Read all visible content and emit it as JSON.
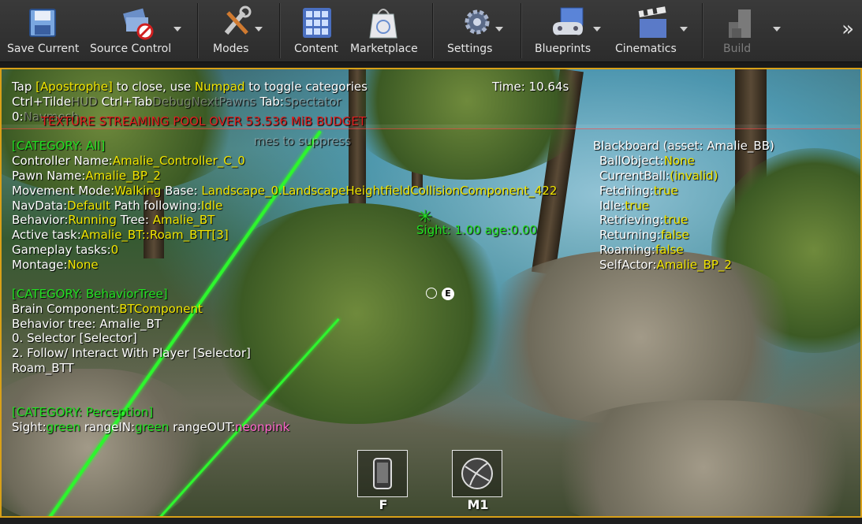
{
  "toolbar": {
    "save": "Save Current",
    "source_control": "Source Control",
    "modes": "Modes",
    "content": "Content",
    "marketplace": "Marketplace",
    "settings": "Settings",
    "blueprints": "Blueprints",
    "cinematics": "Cinematics",
    "build": "Build",
    "overflow": "»"
  },
  "hud": {
    "tap_a": "Tap ",
    "tap_key": "[Apostrophe]",
    "tap_b": " to close, use ",
    "tap_numpad": "Numpad",
    "tap_c": " to toggle categories",
    "time": "Time: 10.64s",
    "ctrl_tilde": "Ctrl+Tilde",
    "hud_word": "HUD",
    "ctrl_tab": "Ctrl+Tab",
    "ctrl_tab_faded": "DebugNextPawns",
    "tab_key": "Tab:",
    "spectator": "Spectator",
    "navmesh_key": "0:",
    "navmesh": "Navmesh",
    "texture_warning": "TEXTURE STREAMING POOL OVER 53.536 MiB BUDGET",
    "suppress": "mes to suppress",
    "cat_all": "[CATEGORY: All]",
    "controller_label": "Controller Name:",
    "controller_value": "Amalie_Controller_C_0",
    "pawn_label": "Pawn Name:",
    "pawn_value": "Amalie_BP_2",
    "movement_label": "Movement Mode:",
    "movement_value": "Walking",
    "base_label": " Base: ",
    "base_value": "Landscape_0.LandscapeHeightfieldCollisionComponent_422",
    "navdata_label": "NavData:",
    "navdata_value": "Default",
    "path_label": " Path following:",
    "path_value": "Idle",
    "behavior_label": "Behavior:",
    "behavior_value": "Running",
    "tree_label": " Tree: ",
    "tree_value": "Amalie_BT",
    "active_label": "Active task:",
    "active_value": "Amalie_BT::Roam_BTT[3]",
    "gameplay_label": "Gameplay tasks:",
    "gameplay_value": "0",
    "montage_label": "Montage:",
    "montage_value": "None",
    "cat_bt": "[CATEGORY: BehaviorTree]",
    "brain_label": "Brain Component:",
    "brain_value": "BTComponent",
    "bt_label": "Behavior tree: Amalie_BT",
    "bt_line1": " 0. Selector [Selector]",
    "bt_line2": " 2. Follow/ Interact With Player [Selector]",
    "bt_line3": " Roam_BTT",
    "cat_perception": "[CATEGORY: Perception]",
    "sight_label": "Sight:",
    "sight_value": "green",
    "rangein_label": " rangeIN:",
    "rangein_value": "green",
    "rangeout_label": " rangeOUT:",
    "rangeout_value": "neonpink",
    "sight_marker": "Sight: 1.00 age:0.00",
    "bb_title": "Blackboard (asset: Amalie_BB)",
    "bb_ballobject_label": "BallObject:",
    "bb_ballobject_value": "None",
    "bb_currentball_label": "CurrentBall:",
    "bb_currentball_value": "(invalid)",
    "bb_fetching_label": "Fetching:",
    "bb_fetching_value": "true",
    "bb_idle_label": "Idle:",
    "bb_idle_value": "true",
    "bb_retrieving_label": "Retrieving:",
    "bb_retrieving_value": "true",
    "bb_returning_label": "Returning:",
    "bb_returning_value": "false",
    "bb_roaming_label": "Roaming:",
    "bb_roaming_value": "false",
    "bb_selfactor_label": "SelfActor:",
    "bb_selfactor_value": "Amalie_BP_2"
  },
  "interact_key": "E",
  "slots": [
    {
      "key": "F",
      "icon": "phone-icon"
    },
    {
      "key": "M1",
      "icon": "ball-icon"
    }
  ]
}
